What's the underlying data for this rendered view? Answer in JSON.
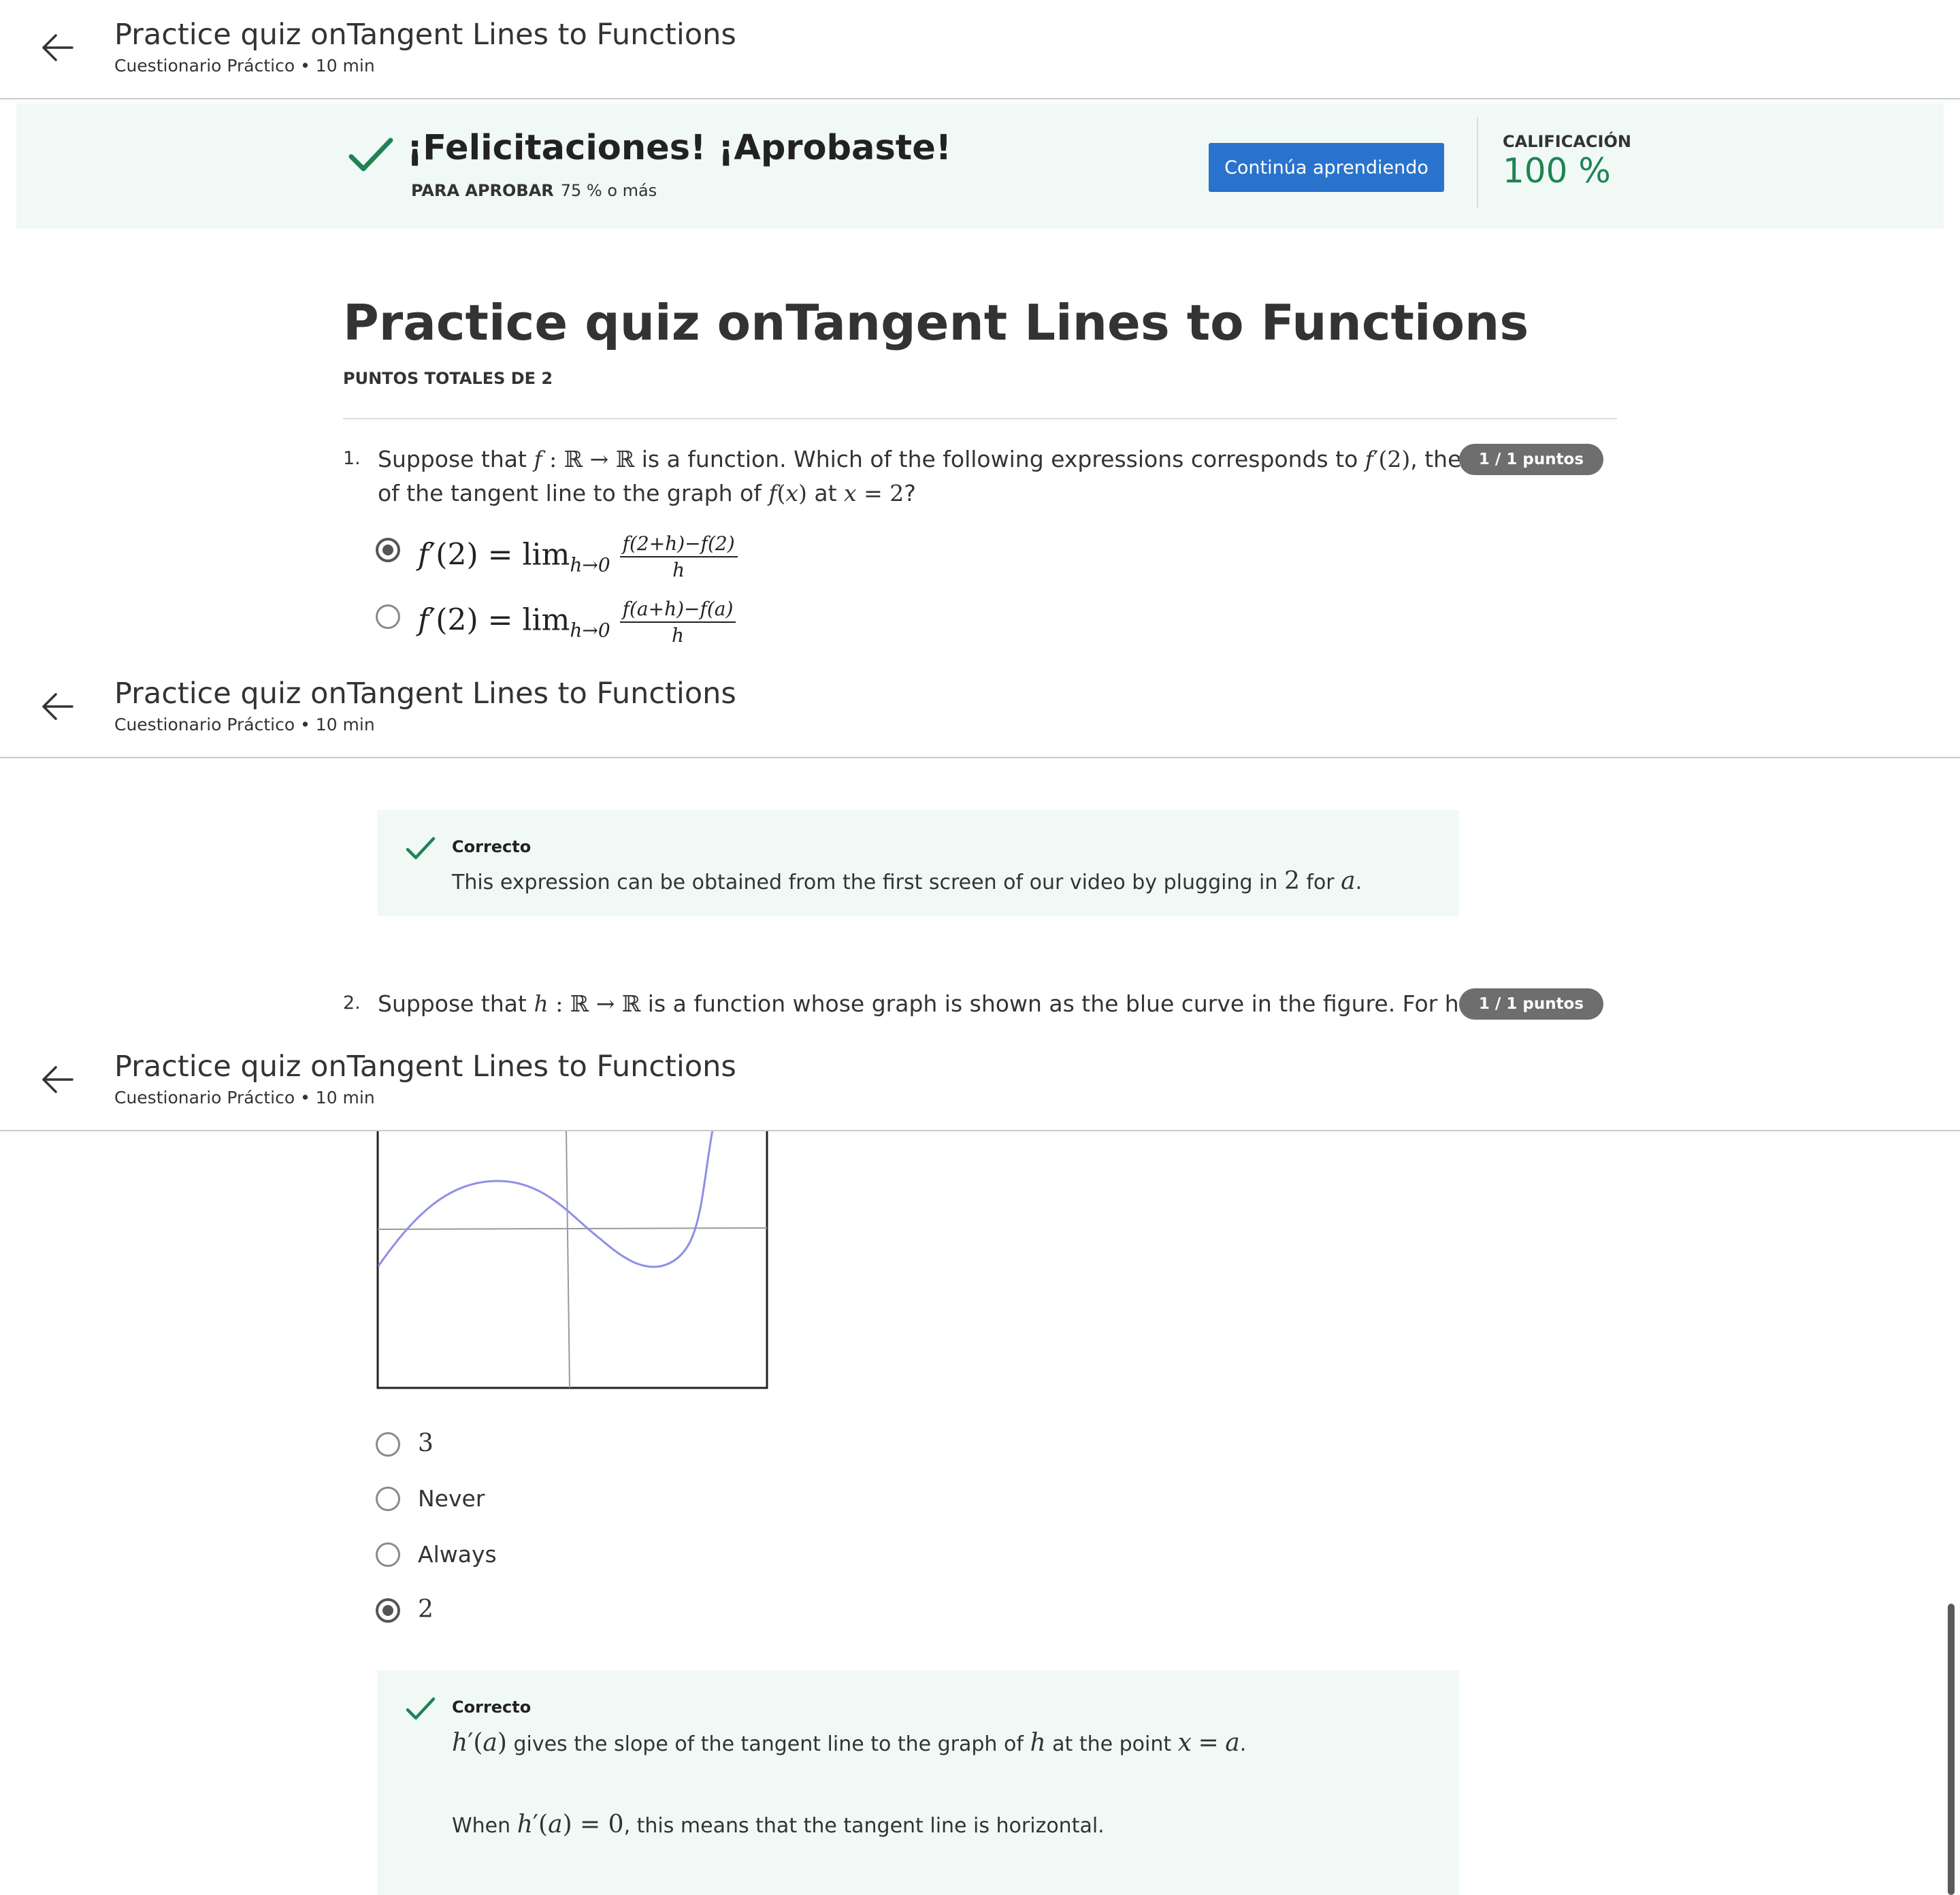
{
  "header": {
    "title": "Practice quiz onTangent Lines to Functions",
    "subtitle": "Cuestionario Práctico • 10 min",
    "back_icon": "arrow-left-icon"
  },
  "banner": {
    "message": "¡Felicitaciones! ¡Aprobaste!",
    "pass_label": "PARA APROBAR",
    "pass_value": "75 % o más",
    "continue_button": "Continúa aprendiendo",
    "grade_label": "CALIFICACIÓN",
    "grade_value": "100 %",
    "accent_color": "#1f8354",
    "button_color": "#2a73cc",
    "check_icon": "check-icon"
  },
  "page": {
    "title": "Practice quiz onTangent Lines to Functions",
    "total_points": "PUNTOS TOTALES DE 2"
  },
  "questions": [
    {
      "number": "1.",
      "points": "1 / 1 puntos",
      "text_line1": "Suppose that f : ℝ → ℝ is a function. Which of the following expressions corresponds to f′(2), the slope",
      "text_line2": "of the tangent line to the graph of f(x) at x = 2?",
      "options": [
        {
          "lhs": "f′(2) = lim",
          "sub": "h→0",
          "num": "f(2+h)−f(2)",
          "den": "h",
          "selected": true
        },
        {
          "lhs": "f′(2) = lim",
          "sub": "h→0",
          "num": "f(a+h)−f(a)",
          "den": "h",
          "selected": false
        }
      ],
      "feedback": {
        "title": "Correcto",
        "text": "This expression can be obtained from the first screen of our video by plugging in 2 for a."
      }
    },
    {
      "number": "2.",
      "points": "1 / 1 puntos",
      "text_line1": "Suppose that h : ℝ → ℝ is a function whose graph is shown as the blue curve in the figure. For how many",
      "options": [
        {
          "label": "3",
          "selected": false
        },
        {
          "label": "Never",
          "selected": false
        },
        {
          "label": "Always",
          "selected": false
        },
        {
          "label": "2",
          "selected": true
        }
      ],
      "feedback": {
        "title": "Correcto",
        "line1": "h′(a) gives the slope of the tangent line to the graph of h at the point x = a.",
        "line2": "When h′(a) = 0, this means that the tangent line is horizontal."
      }
    }
  ],
  "curve_color": "#8f8fe6"
}
